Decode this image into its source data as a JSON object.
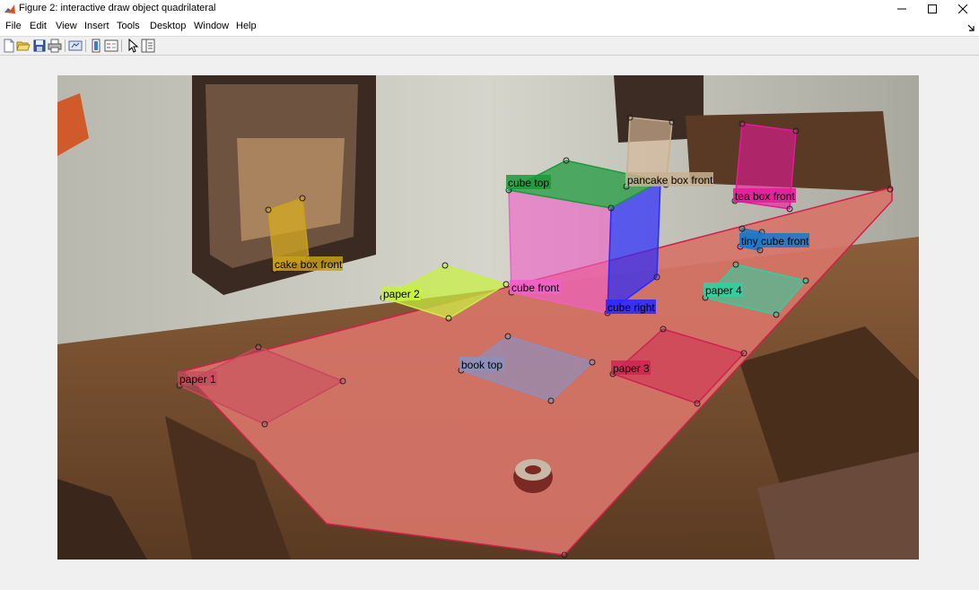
{
  "window": {
    "title": "Figure 2: interactive draw object quadrilateral",
    "icon": "matlab-logo-icon",
    "controls": [
      "minimize-icon",
      "maximize-icon",
      "close-icon"
    ]
  },
  "menu": {
    "items": [
      "File",
      "Edit",
      "View",
      "Insert",
      "Tools",
      "Desktop",
      "Window",
      "Help"
    ]
  },
  "toolbar": {
    "buttons": [
      "new-figure-icon",
      "open-file-icon",
      "save-icon",
      "print-icon",
      "link-plot-icon",
      "insert-colorbar-icon",
      "insert-legend-icon",
      "edit-plot-arrow-icon",
      "property-inspector-icon"
    ]
  },
  "annotations": [
    {
      "label": "cube top",
      "color": "#1a9a3a"
    },
    {
      "label": "pancake box front",
      "color": "#c8b090"
    },
    {
      "label": "tea box front",
      "color": "#e8189a"
    },
    {
      "label": "cake box front",
      "color": "#c8a018"
    },
    {
      "label": "tiny cube front",
      "color": "#1f78c8"
    },
    {
      "label": "paper 2",
      "color": "#c8f040"
    },
    {
      "label": "cube front",
      "color": "#f060c8"
    },
    {
      "label": "paper 4",
      "color": "#30d0a0"
    },
    {
      "label": "cube right",
      "color": "#2a2aff"
    },
    {
      "label": "book top",
      "color": "#8a90c0"
    },
    {
      "label": "paper 3",
      "color": "#d02050"
    },
    {
      "label": "paper 1",
      "color": "#c84860"
    }
  ]
}
